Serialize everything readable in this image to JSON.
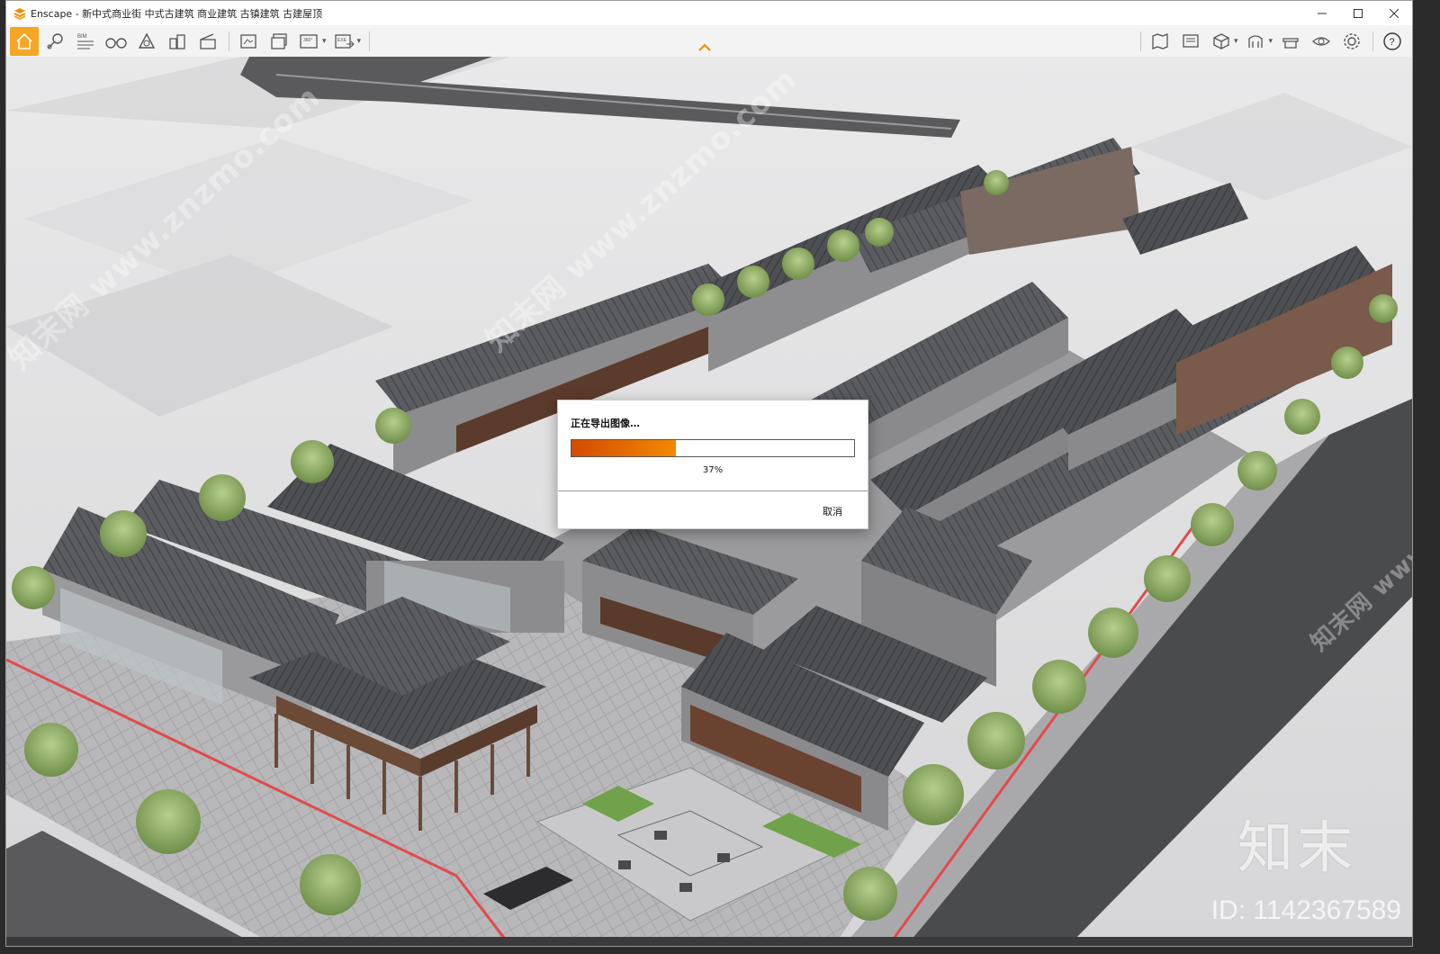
{
  "window": {
    "title": "Enscape - 新中式商业街 中式古建筑 商业建筑 古镇建筑 古建屋顶"
  },
  "toolbar": {
    "left_tools": [
      {
        "name": "home-icon"
      },
      {
        "name": "view-management-icon"
      },
      {
        "name": "bim-icon",
        "label": "BIM"
      },
      {
        "name": "binoculars-icon"
      },
      {
        "name": "asset-library-icon"
      },
      {
        "name": "buildings-icon"
      },
      {
        "name": "clapperboard-icon"
      },
      {
        "name": "screenshot-icon"
      },
      {
        "name": "batch-render-icon"
      },
      {
        "name": "panorama-360-icon",
        "label": "360°"
      },
      {
        "name": "export-exe-icon",
        "label": "EXE"
      }
    ],
    "right_tools": [
      {
        "name": "map-icon"
      },
      {
        "name": "presentation-icon"
      },
      {
        "name": "cube-icon"
      },
      {
        "name": "vr-headset-icon"
      },
      {
        "name": "material-editor-icon"
      },
      {
        "name": "visual-settings-eye-icon"
      },
      {
        "name": "settings-gear-icon"
      },
      {
        "name": "help-icon"
      }
    ]
  },
  "colors": {
    "accent": "#f5a623",
    "progress_start": "#d44a00",
    "progress_end": "#f08a00"
  },
  "export_dialog": {
    "title": "正在导出图像…",
    "progress": 0.37,
    "progress_label": "37%",
    "cancel_label": "取消"
  },
  "watermarks": {
    "site": "知末网 www.znzmo.com",
    "brand": "知末",
    "image_id": "ID: 1142367589"
  }
}
